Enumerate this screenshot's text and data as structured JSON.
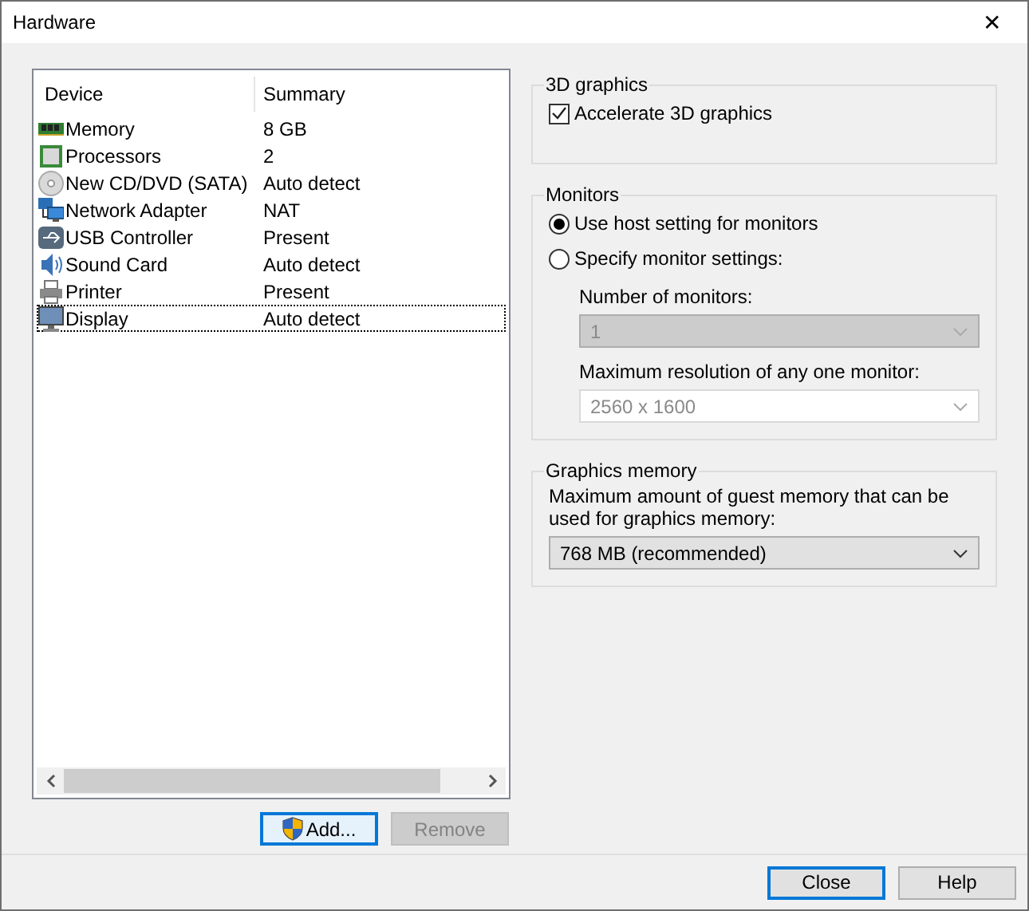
{
  "window": {
    "title": "Hardware",
    "close": "✕"
  },
  "devices": {
    "columns": [
      "Device",
      "Summary"
    ],
    "rows": [
      {
        "kind": "memory",
        "name": "Memory",
        "summary": "8 GB",
        "selected": false
      },
      {
        "kind": "processor",
        "name": "Processors",
        "summary": "2",
        "selected": false
      },
      {
        "kind": "disc",
        "name": "New CD/DVD (SATA)",
        "summary": "Auto detect",
        "selected": false
      },
      {
        "kind": "network",
        "name": "Network Adapter",
        "summary": "NAT",
        "selected": false
      },
      {
        "kind": "usb",
        "name": "USB Controller",
        "summary": "Present",
        "selected": false
      },
      {
        "kind": "sound",
        "name": "Sound Card",
        "summary": "Auto detect",
        "selected": false
      },
      {
        "kind": "printer",
        "name": "Printer",
        "summary": "Present",
        "selected": false
      },
      {
        "kind": "display",
        "name": "Display",
        "summary": "Auto detect",
        "selected": true
      }
    ]
  },
  "list_buttons": [
    {
      "label": "Add...",
      "disabled": false,
      "focused": true,
      "shield": true
    },
    {
      "label": "Remove",
      "disabled": true,
      "focused": false,
      "shield": false
    }
  ],
  "graphics3d": {
    "title": "3D graphics",
    "checkbox": {
      "label": "Accelerate 3D graphics",
      "checked": true
    }
  },
  "monitors": {
    "title": "Monitors",
    "options": [
      {
        "label": "Use host setting for monitors",
        "selected": true
      },
      {
        "label": "Specify monitor settings:",
        "selected": false
      }
    ],
    "number_label": "Number of monitors:",
    "number_value": "1",
    "number_disabled": true,
    "resolution_label": "Maximum resolution of any one monitor:",
    "resolution_value": "2560 x 1600",
    "resolution_disabled": true
  },
  "graphics_memory": {
    "title": "Graphics memory",
    "label": "Maximum amount of guest memory that can be used for graphics memory:",
    "value": "768 MB (recommended)"
  },
  "footer_buttons": [
    {
      "label": "Close",
      "focused": true
    },
    {
      "label": "Help",
      "focused": false
    }
  ]
}
